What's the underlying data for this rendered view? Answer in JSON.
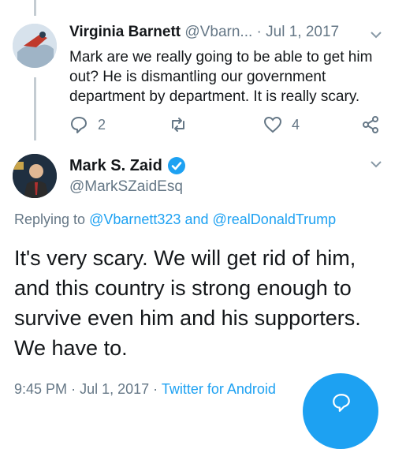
{
  "tweet1": {
    "name": "Virginia Barnett",
    "handle": "@Vbarn...",
    "separator": "·",
    "date": "Jul 1, 2017",
    "text": "Mark are we really going to be able to get him out? He is dismantling our government department by department. It is really scary.",
    "reply_count": "2",
    "like_count": "4"
  },
  "tweet2": {
    "name": "Mark S. Zaid",
    "handle": "@MarkSZaidEsq",
    "replying_prefix": "Replying to",
    "reply_user1": "@Vbarnett323",
    "reply_and": "and",
    "reply_user2": "@realDonaldTrump",
    "text": "It's very scary. We will get rid of him, and this country is strong enough to survive even him and his supporters. We have to.",
    "time": "9:45 PM",
    "sep1": "·",
    "date": "Jul 1, 2017",
    "sep2": "·",
    "source": "Twitter for Android"
  },
  "colors": {
    "accent": "#1da1f2",
    "muted": "#657786",
    "text": "#14171a"
  },
  "icons": [
    "reply-icon",
    "retweet-icon",
    "like-icon",
    "share-icon",
    "verified-icon",
    "chevron-down-icon",
    "compose-icon"
  ]
}
